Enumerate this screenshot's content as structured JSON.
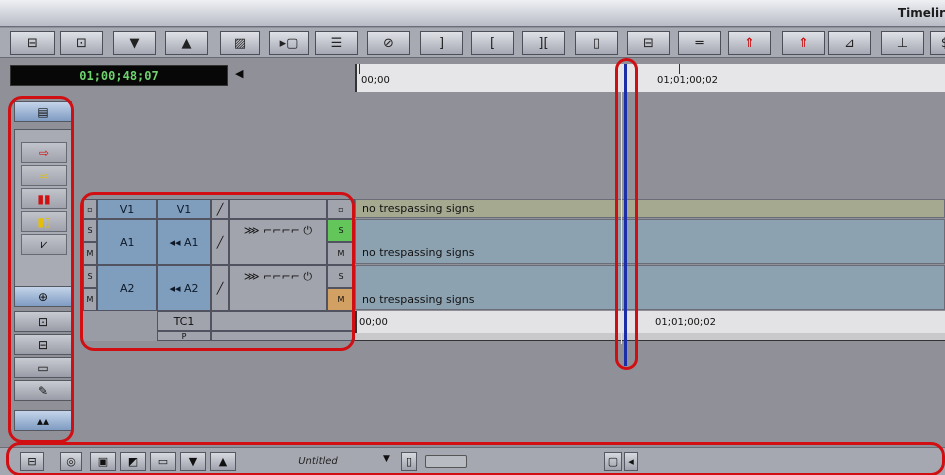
{
  "window": {
    "title": "Timelir"
  },
  "toolbar": {
    "buttons": [
      {
        "name": "segment-mode-icon",
        "glyph": "⊟"
      },
      {
        "name": "clip-icon",
        "glyph": "⊡"
      },
      {
        "name": "move-down-icon",
        "glyph": "▼"
      },
      {
        "name": "move-up-icon",
        "glyph": "▲"
      },
      {
        "name": "grid-icon",
        "glyph": "▨"
      },
      {
        "name": "play-clip-icon",
        "glyph": "▸▢"
      },
      {
        "name": "lift-icon",
        "glyph": "☰"
      },
      {
        "name": "clear-icon",
        "glyph": "⊘"
      },
      {
        "name": "mark-out-icon",
        "glyph": "]"
      },
      {
        "name": "mark-in-icon",
        "glyph": "["
      },
      {
        "name": "mark-clip-icon",
        "glyph": "]["
      },
      {
        "name": "clear-marks-icon",
        "glyph": "▯"
      },
      {
        "name": "splice-icon",
        "glyph": "⊟"
      },
      {
        "name": "overwrite-icon",
        "glyph": "═"
      },
      {
        "name": "lift-up-icon",
        "glyph": "⇑"
      },
      {
        "name": "extract-icon",
        "glyph": "⇑"
      },
      {
        "name": "trim-icon",
        "glyph": "⊿"
      },
      {
        "name": "ripple-icon",
        "glyph": "⊥"
      },
      {
        "name": "more-icon",
        "glyph": "$"
      }
    ]
  },
  "timecode": {
    "display": "01;00;48;07"
  },
  "ruler": {
    "start": "00;00",
    "mark": "01;01;00;02"
  },
  "palette": {
    "items": [
      {
        "name": "track-list-icon",
        "glyph": "▤"
      },
      {
        "name": "red-arrow-icon",
        "glyph": "⇨"
      },
      {
        "name": "yellow-arrow-icon",
        "glyph": "⇨"
      },
      {
        "name": "red-segment-icon",
        "glyph": "▮▮"
      },
      {
        "name": "yellow-segment-icon",
        "glyph": "▮▯"
      },
      {
        "name": "waveform-icon",
        "glyph": "⩗"
      },
      {
        "name": "sync-icon",
        "glyph": "⊕"
      },
      {
        "name": "clip-frame-icon",
        "glyph": "⊡"
      },
      {
        "name": "audio-mix-icon",
        "glyph": "⊟"
      },
      {
        "name": "film-strip-icon",
        "glyph": "▭"
      },
      {
        "name": "pencil-icon",
        "glyph": "✎"
      },
      {
        "name": "collapse-icon",
        "glyph": "▴▴"
      }
    ]
  },
  "tracks": {
    "v1": {
      "source": "V1",
      "record": "V1"
    },
    "a1": {
      "source": "A1",
      "record": "A1"
    },
    "a2": {
      "source": "A2",
      "record": "A2"
    },
    "tc": "TC1",
    "p": "P",
    "solo": "S",
    "mute": "M"
  },
  "clips": {
    "v1": "no trespassing signs",
    "a1": "no trespassing signs",
    "a2": "no trespassing signs"
  },
  "tcbar": {
    "start": "00;00",
    "mark": "01;01;00;02"
  },
  "bottom": {
    "sequence": "Untitled"
  },
  "colors": {
    "highlight": "#d10f12",
    "timecode": "#6fd26f",
    "position": "#1b2ea8"
  }
}
